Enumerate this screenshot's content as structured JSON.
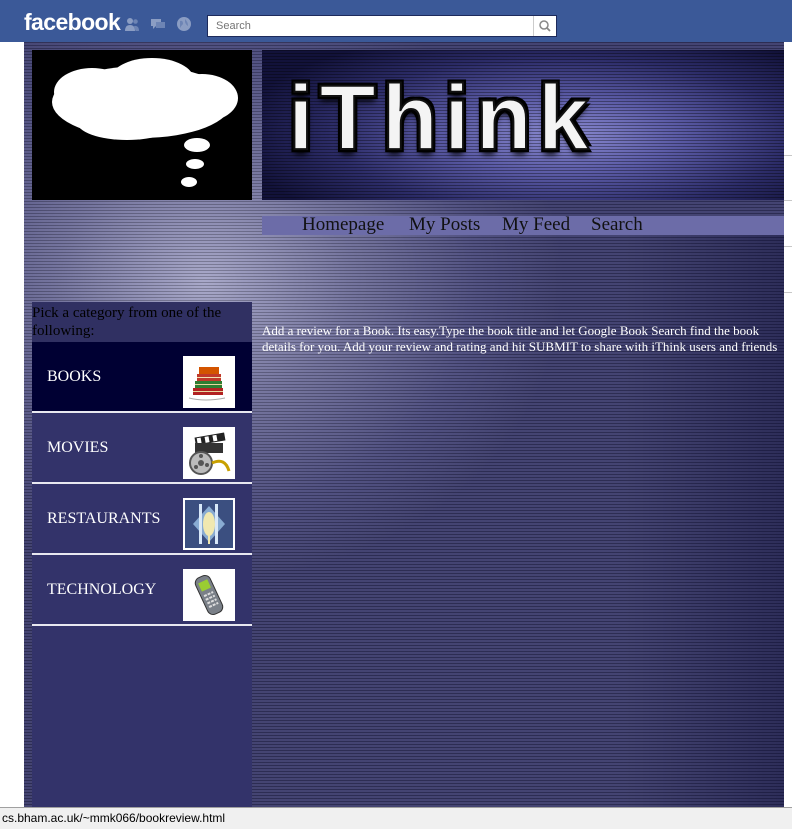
{
  "facebook": {
    "logo_text": "facebook",
    "search_placeholder": "Search",
    "icons": [
      "friend-requests-icon",
      "messages-icon",
      "notifications-globe-icon",
      "search-magnifier-icon"
    ],
    "bar_color": "#3b5998"
  },
  "app": {
    "banner_title": "iThink",
    "nav": [
      "Homepage",
      "My Posts",
      "My Feed",
      "Search"
    ],
    "category_heading": "Pick a category from one of the following:",
    "categories": [
      {
        "label": "BOOKS",
        "icon": "books-icon"
      },
      {
        "label": "MOVIES",
        "icon": "film-reel-icon"
      },
      {
        "label": "RESTAURANTS",
        "icon": "cutlery-icon"
      },
      {
        "label": "TECHNOLOGY",
        "icon": "mobile-phone-icon"
      }
    ],
    "intro_line1": "Add a review for a Book. Its easy.Type the book title and let Google Book Search find the book",
    "intro_line2": "details for you. Add your review and rating and hit SUBMIT to share with iThink users and friends"
  },
  "status": {
    "url": "cs.bham.ac.uk/~mmk066/bookreview.html"
  }
}
